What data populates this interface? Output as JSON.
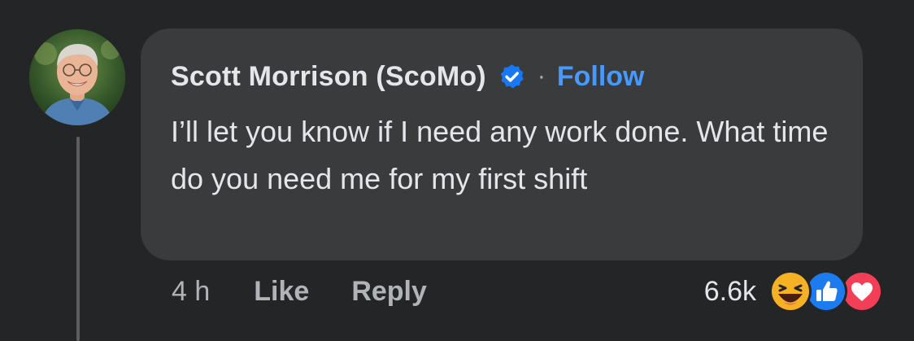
{
  "comment": {
    "author": "Scott Morrison (ScoMo)",
    "separator": "·",
    "follow_label": "Follow",
    "text": "I’ll let you know if I need any work done. What time do you need me for my first shift"
  },
  "meta": {
    "timestamp": "4 h",
    "like_label": "Like",
    "reply_label": "Reply"
  },
  "reactions": {
    "count": "6.6k",
    "types": [
      "haha-icon",
      "like-icon",
      "love-icon"
    ]
  },
  "colors": {
    "background": "#242526",
    "bubble": "#3a3b3c",
    "primary_text": "#e4e6eb",
    "secondary_text": "#b0b3b8",
    "link": "#4599ff",
    "verified_badge": "#1877f2",
    "love": "#f33e58",
    "haha": "#f7b125"
  }
}
